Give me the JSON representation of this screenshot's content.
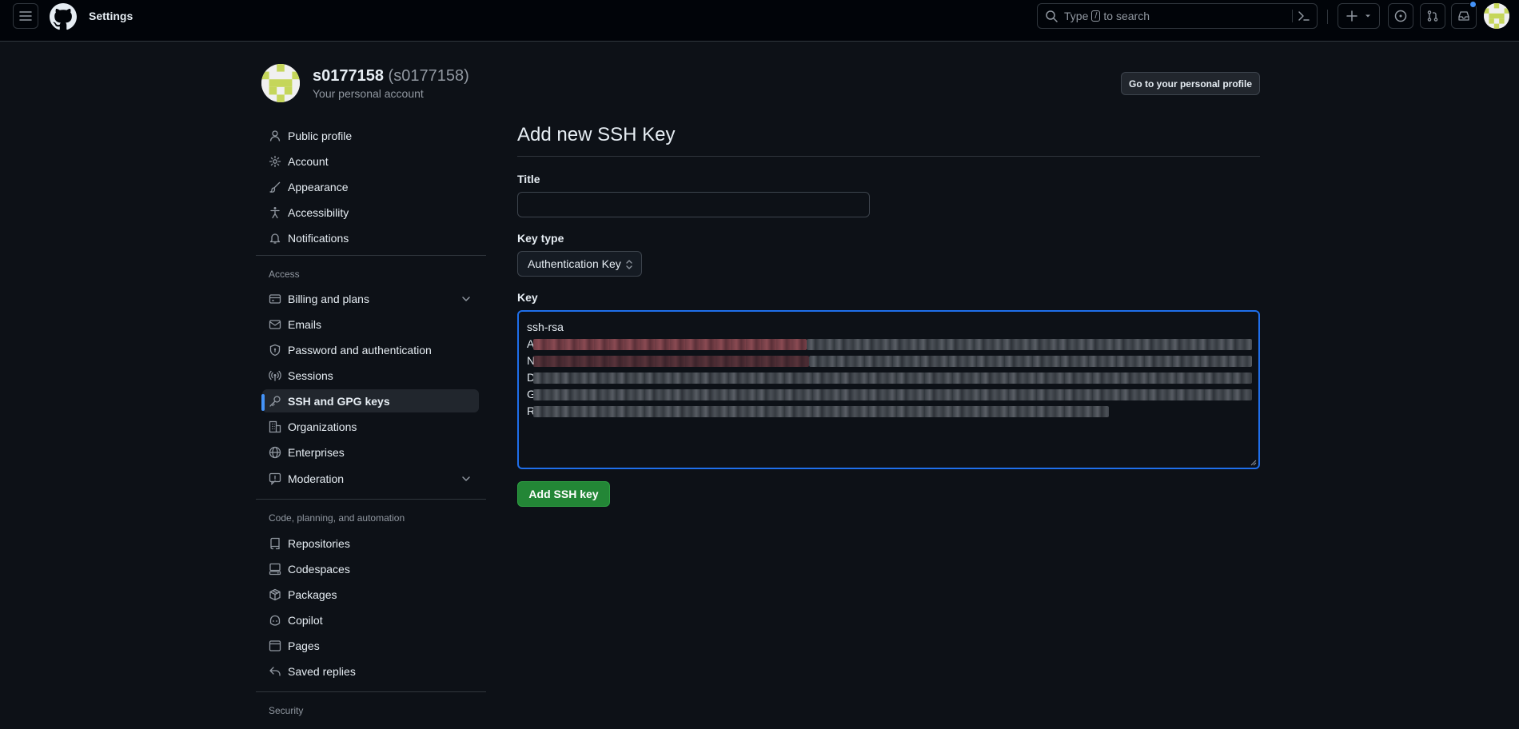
{
  "header": {
    "title": "Settings",
    "search_prefix": "Type",
    "search_kbd": "/",
    "search_suffix": "to search",
    "icons": [
      "hamburger-icon",
      "github-logo",
      "search-icon",
      "command-palette-icon",
      "plus-icon",
      "caret-down-icon",
      "issue-icon",
      "pull-request-icon",
      "inbox-icon"
    ]
  },
  "profile": {
    "name": "s0177158",
    "login": "(s0177158)",
    "subtitle": "Your personal account",
    "go_profile_label": "Go to your personal profile"
  },
  "sidebar": {
    "items": [
      {
        "label": "Public profile",
        "icon": "person-icon"
      },
      {
        "label": "Account",
        "icon": "gear-icon"
      },
      {
        "label": "Appearance",
        "icon": "paintbrush-icon"
      },
      {
        "label": "Accessibility",
        "icon": "accessibility-icon"
      },
      {
        "label": "Notifications",
        "icon": "bell-icon"
      }
    ],
    "access_heading": "Access",
    "access_items": [
      {
        "label": "Billing and plans",
        "icon": "credit-card-icon"
      },
      {
        "label": "Emails",
        "icon": "mail-icon"
      },
      {
        "label": "Password and authentication",
        "icon": "shield-lock-icon"
      },
      {
        "label": "Sessions",
        "icon": "broadcast-icon"
      },
      {
        "label": "SSH and GPG keys",
        "icon": "key-icon",
        "active": true
      },
      {
        "label": "Organizations",
        "icon": "organization-icon"
      },
      {
        "label": "Enterprises",
        "icon": "globe-icon"
      },
      {
        "label": "Moderation",
        "icon": "report-icon"
      }
    ],
    "code_heading": "Code, planning, and automation",
    "code_items": [
      {
        "label": "Repositories",
        "icon": "repo-icon"
      },
      {
        "label": "Codespaces",
        "icon": "codespaces-icon"
      },
      {
        "label": "Packages",
        "icon": "package-icon"
      },
      {
        "label": "Copilot",
        "icon": "copilot-icon"
      },
      {
        "label": "Pages",
        "icon": "browser-icon"
      },
      {
        "label": "Saved replies",
        "icon": "reply-icon"
      }
    ],
    "security_heading": "Security"
  },
  "main": {
    "title": "Add new SSH Key",
    "title_label": "Title",
    "title_value": "",
    "key_type_label": "Key type",
    "key_type_value": "Authentication Key",
    "key_label": "Key",
    "key_first_line": "ssh-rsa",
    "key_line_initials": [
      "A",
      "N",
      "D",
      "G",
      "R"
    ],
    "submit_label": "Add SSH key"
  },
  "colors": {
    "page_bg": "#0d1117",
    "header_bg": "#010409",
    "accent_blue": "#4493f8",
    "focus_border": "#1f6feb",
    "primary_green": "#238636"
  }
}
